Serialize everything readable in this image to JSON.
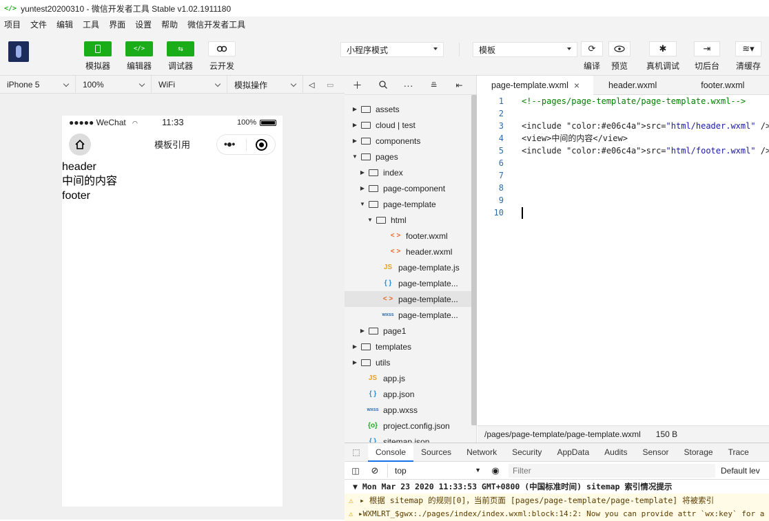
{
  "window": {
    "title": "yuntest20200310 - 微信开发者工具 Stable v1.02.1911180",
    "logo": "</>"
  },
  "menu": [
    "项目",
    "文件",
    "编辑",
    "工具",
    "界面",
    "设置",
    "帮助",
    "微信开发者工具"
  ],
  "toolbar": {
    "buttons": [
      {
        "label": "模拟器",
        "icon": "phone-icon"
      },
      {
        "label": "编辑器",
        "icon": "code-icon"
      },
      {
        "label": "调试器",
        "icon": "debug-icon"
      },
      {
        "label": "云开发",
        "icon": "cloud-icon"
      }
    ],
    "mode_select": "小程序模式",
    "compile_select": "模板",
    "right_buttons": [
      {
        "label": "编译",
        "icon": "refresh-icon"
      },
      {
        "label": "预览",
        "icon": "eye-icon"
      },
      {
        "label": "真机调试",
        "icon": "bug-icon"
      },
      {
        "label": "切后台",
        "icon": "switch-background-icon"
      },
      {
        "label": "清缓存",
        "icon": "layers-icon"
      }
    ]
  },
  "simulator": {
    "device": "iPhone 5",
    "zoom": "100%",
    "network": "WiFi",
    "operation": "模拟操作",
    "status": {
      "carrier": "●●●●● WeChat",
      "time": "11:33",
      "battery": "100%"
    },
    "nav_title": "模板引用",
    "content": [
      "header",
      "中间的内容",
      "footer"
    ]
  },
  "filetree": {
    "items": [
      {
        "label": "assets",
        "type": "folder",
        "depth": 0,
        "expanded": false
      },
      {
        "label": "cloud | test",
        "type": "folder-cloud",
        "depth": 0,
        "expanded": false
      },
      {
        "label": "components",
        "type": "folder",
        "depth": 0,
        "expanded": false
      },
      {
        "label": "pages",
        "type": "folder",
        "depth": 0,
        "expanded": true
      },
      {
        "label": "index",
        "type": "folder",
        "depth": 1,
        "expanded": false
      },
      {
        "label": "page-component",
        "type": "folder",
        "depth": 1,
        "expanded": false
      },
      {
        "label": "page-template",
        "type": "folder",
        "depth": 1,
        "expanded": true
      },
      {
        "label": "html",
        "type": "folder",
        "depth": 2,
        "expanded": true
      },
      {
        "label": "footer.wxml",
        "type": "wxml",
        "depth": 3
      },
      {
        "label": "header.wxml",
        "type": "wxml",
        "depth": 3
      },
      {
        "label": "page-template.js",
        "type": "js",
        "depth": 2
      },
      {
        "label": "page-template...",
        "type": "json",
        "depth": 2
      },
      {
        "label": "page-template...",
        "type": "wxml",
        "depth": 2,
        "selected": true
      },
      {
        "label": "page-template...",
        "type": "wxss",
        "depth": 2
      },
      {
        "label": "page1",
        "type": "folder",
        "depth": 1,
        "expanded": false
      },
      {
        "label": "templates",
        "type": "folder",
        "depth": 0,
        "expanded": false
      },
      {
        "label": "utils",
        "type": "folder",
        "depth": 0,
        "expanded": false
      },
      {
        "label": "app.js",
        "type": "js",
        "depth": 0
      },
      {
        "label": "app.json",
        "type": "json",
        "depth": 0
      },
      {
        "label": "app.wxss",
        "type": "wxss",
        "depth": 0
      },
      {
        "label": "project.config.json",
        "type": "config",
        "depth": 0
      },
      {
        "label": "sitemap.json",
        "type": "json",
        "depth": 0
      }
    ]
  },
  "editor": {
    "tabs": [
      {
        "label": "page-template.wxml",
        "active": true,
        "close": "×"
      },
      {
        "label": "header.wxml",
        "active": false
      },
      {
        "label": "footer.wxml",
        "active": false
      }
    ],
    "lines": [
      "<!--pages/page-template/page-template.wxml-->",
      "",
      "<include src=\"html/header.wxml\" />",
      "<view>中间的内容</view>",
      "<include src=\"html/footer.wxml\" />",
      "",
      "",
      "",
      "",
      ""
    ],
    "path": "/pages/page-template/page-template.wxml",
    "size": "150 B"
  },
  "devtools": {
    "tabs": [
      "Console",
      "Sources",
      "Network",
      "Security",
      "AppData",
      "Audits",
      "Sensor",
      "Storage",
      "Trace"
    ],
    "context": "top",
    "filter_placeholder": "Filter",
    "levels": "Default lev",
    "logs": [
      {
        "text": "▼ Mon Mar 23 2020 11:33:53 GMT+0800 (中国标准时间) sitemap 索引情况提示",
        "level": "group"
      },
      {
        "text": "▸ 根据 sitemap 的规则[0]，当前页面 [pages/page-template/page-template] 将被索引",
        "level": "warn"
      },
      {
        "text": "▸WXMLRT_$gwx:./pages/index/index.wxml:block:14:2: Now you can provide attr `wx:key` for a",
        "level": "warn"
      }
    ]
  },
  "colors": {
    "accent_green": "#1aad19",
    "selected_row": "#e4e4e4",
    "warn_bg": "#fffbe6"
  }
}
